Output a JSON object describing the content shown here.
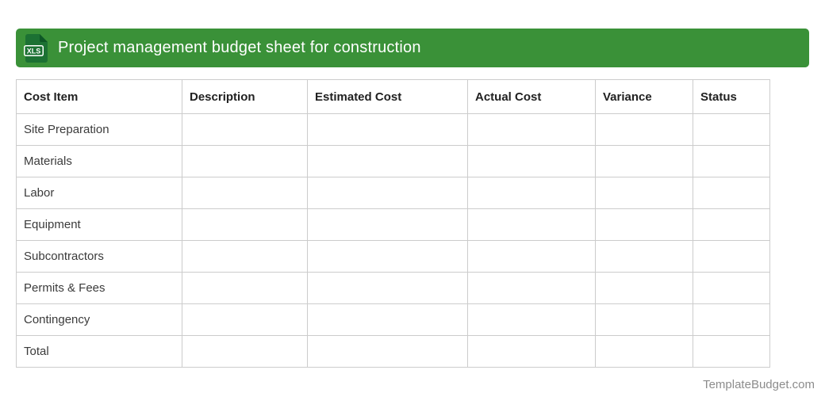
{
  "header": {
    "title": "Project management budget sheet for construction",
    "icon_label": "XLS",
    "bar_color": "#3a9138",
    "icon_color": "#1c7133"
  },
  "table": {
    "columns": [
      "Cost Item",
      "Description",
      "Estimated Cost",
      "Actual Cost",
      "Variance",
      "Status"
    ],
    "rows": [
      "Site Preparation",
      "Materials",
      "Labor",
      "Equipment",
      "Subcontractors",
      "Permits & Fees",
      "Contingency",
      "Total"
    ]
  },
  "footer": {
    "site_label": "TemplateBudget.com"
  }
}
